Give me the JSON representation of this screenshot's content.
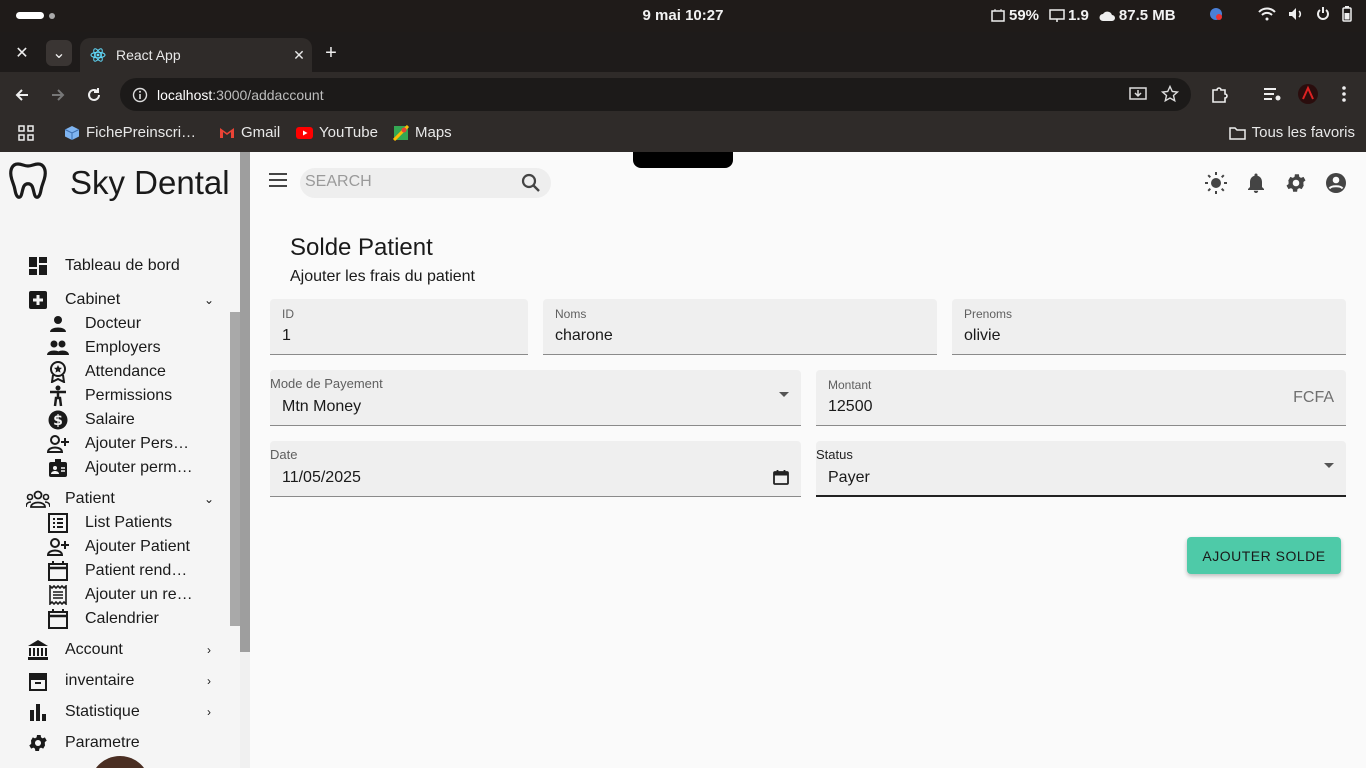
{
  "os": {
    "clock": "9 mai  10:27",
    "cpu": "59%",
    "load": "1.9",
    "memory": "87.5 MB"
  },
  "browser": {
    "tab_title": "React App",
    "url_host": "localhost",
    "url_path": ":3000/addaccount",
    "bookmarks": [
      "FichePreinscri…",
      "Gmail",
      "YouTube",
      "Maps"
    ],
    "all_bookmarks": "Tous les favoris"
  },
  "sidebar": {
    "brand": "Sky Dental",
    "items": [
      {
        "label": "Tableau de bord",
        "icon": "dashboard-icon"
      },
      {
        "label": "Cabinet",
        "icon": "medical-cross-icon",
        "expanded": true
      },
      {
        "label": "Patient",
        "icon": "groups-icon",
        "expanded": true
      },
      {
        "label": "Account",
        "icon": "bank-icon",
        "expanded": false
      },
      {
        "label": "inventaire",
        "icon": "archive-icon",
        "expanded": false
      },
      {
        "label": "Statistique",
        "icon": "bar-chart-icon",
        "expanded": false
      },
      {
        "label": "Parametre",
        "icon": "gear-icon"
      }
    ],
    "cabinet_sub": [
      {
        "label": "Docteur",
        "icon": "person-icon"
      },
      {
        "label": "Employers",
        "icon": "people-icon"
      },
      {
        "label": "Attendance",
        "icon": "badge-icon"
      },
      {
        "label": "Permissions",
        "icon": "accessibility-icon"
      },
      {
        "label": "Salaire",
        "icon": "money-icon"
      },
      {
        "label": "Ajouter Pers…",
        "icon": "person-add-icon"
      },
      {
        "label": "Ajouter perm…",
        "icon": "id-badge-icon"
      }
    ],
    "patient_sub": [
      {
        "label": "List Patients",
        "icon": "list-icon"
      },
      {
        "label": "Ajouter Patient",
        "icon": "person-add-icon"
      },
      {
        "label": "Patient rend…",
        "icon": "calendar-icon"
      },
      {
        "label": "Ajouter un re…",
        "icon": "receipt-icon"
      },
      {
        "label": "Calendrier",
        "icon": "calendar-icon"
      }
    ]
  },
  "appbar": {
    "search_placeholder": "SEARCH"
  },
  "page": {
    "title": "Solde Patient",
    "subtitle": "Ajouter les frais du patient"
  },
  "form": {
    "id": {
      "label": "ID",
      "value": "1"
    },
    "noms": {
      "label": "Noms",
      "value": "charone"
    },
    "prenoms": {
      "label": "Prenoms",
      "value": "olivie"
    },
    "mode": {
      "label": "Mode de Payement",
      "value": "Mtn Money"
    },
    "montant": {
      "label": "Montant",
      "value": "12500",
      "suffix": "FCFA"
    },
    "date": {
      "label": "Date",
      "value": "11/05/2025"
    },
    "status": {
      "label": "Status",
      "value": "Payer"
    },
    "submit_label": "AJOUTER SOLDE"
  },
  "colors": {
    "accent": "#4ecaa8",
    "chrome_dark": "#2f2b29"
  }
}
